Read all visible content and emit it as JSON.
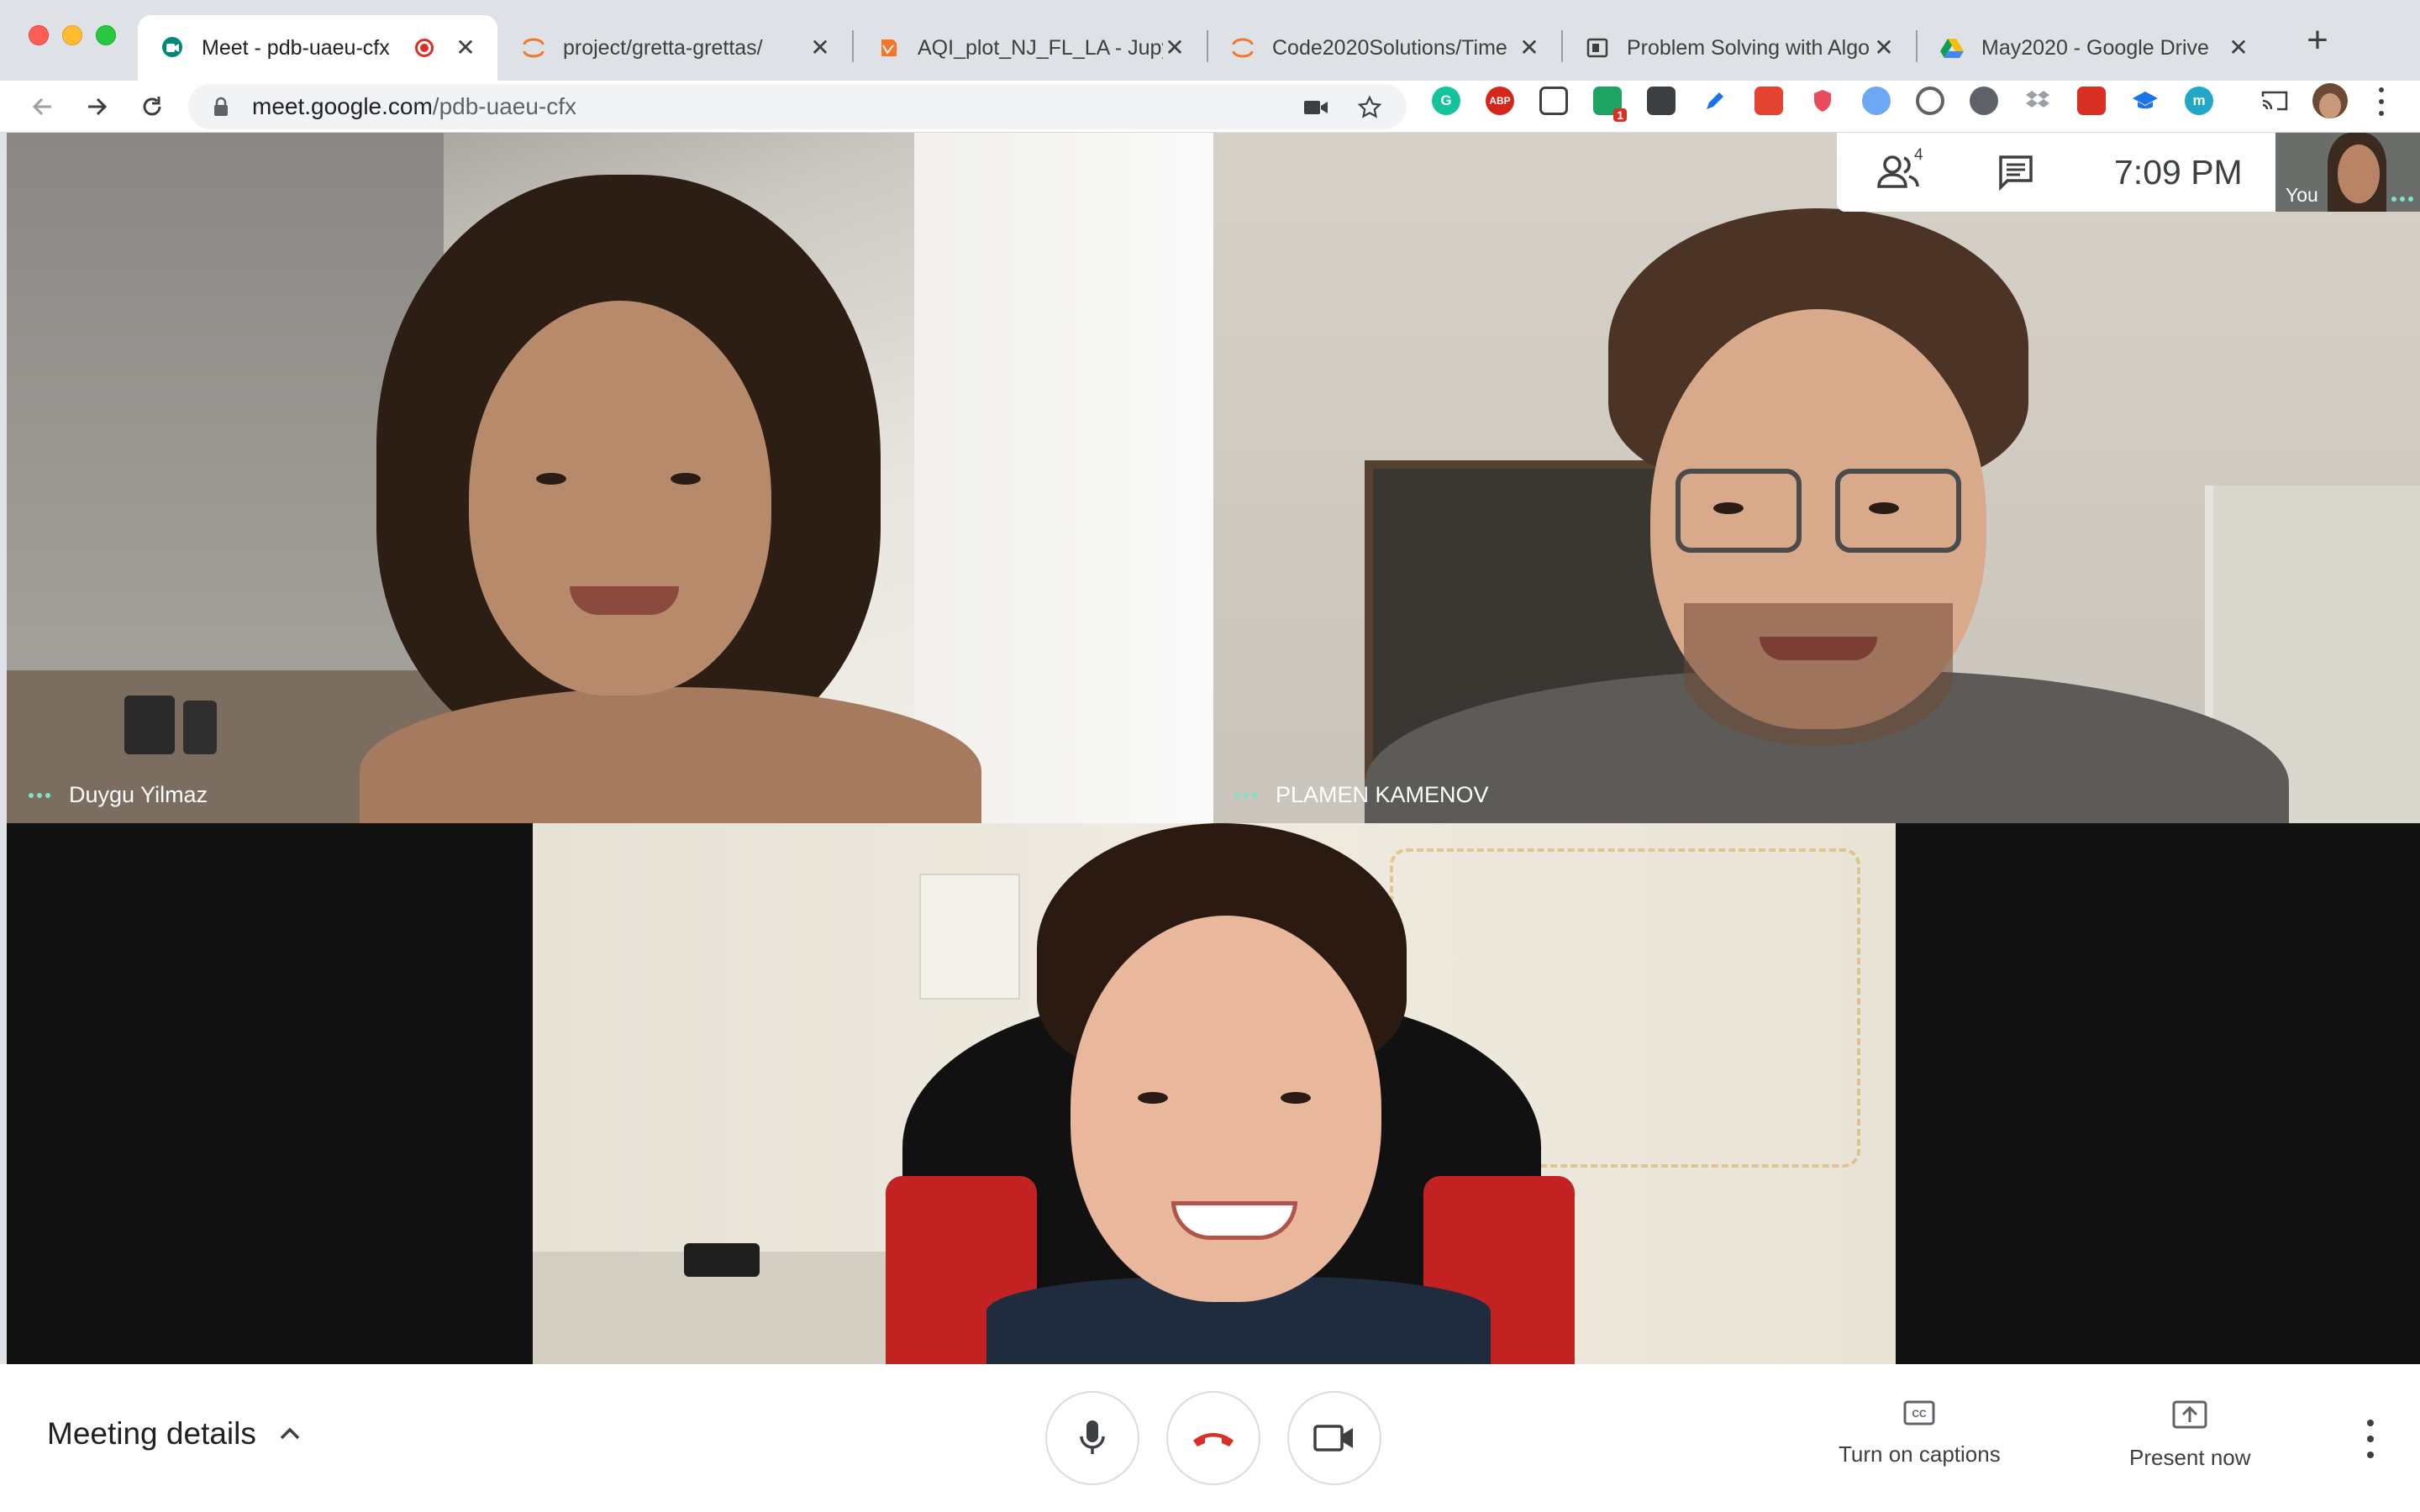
{
  "browser": {
    "tabs": [
      {
        "title": "Meet - pdb-uaeu-cfx",
        "favicon": "google-meet-icon",
        "active": true,
        "recording": true
      },
      {
        "title": "project/gretta-grettas/",
        "favicon": "jupyter-icon"
      },
      {
        "title": "AQI_plot_NJ_FL_LA - Jupy",
        "favicon": "notebook-icon"
      },
      {
        "title": "Code2020Solutions/Time",
        "favicon": "jupyter-icon"
      },
      {
        "title": "Problem Solving with Algo",
        "favicon": "book-icon"
      },
      {
        "title": "May2020 - Google Drive",
        "favicon": "google-drive-icon"
      }
    ],
    "new_tab_label": "+",
    "address": {
      "host": "meet.google.com",
      "path": "/pdb-uaeu-cfx"
    },
    "extension_badge": "1",
    "extension_abp_label": "ABP",
    "extension_letters": {
      "grammarly": "G",
      "m": "m"
    },
    "close_glyph": "✕"
  },
  "meeting": {
    "participants": [
      {
        "name": "Duygu Yilmaz"
      },
      {
        "name": "PLAMEN KAMENOV"
      },
      {
        "name": ""
      }
    ],
    "participant_count": "4",
    "time": "7:09 PM",
    "self_label": "You"
  },
  "controls": {
    "meeting_details": "Meeting details",
    "captions": "Turn on captions",
    "present": "Present now"
  },
  "colors": {
    "meet_accent": "#00897b",
    "hangup": "#d93025",
    "name_dots": "#7fe3c4"
  }
}
